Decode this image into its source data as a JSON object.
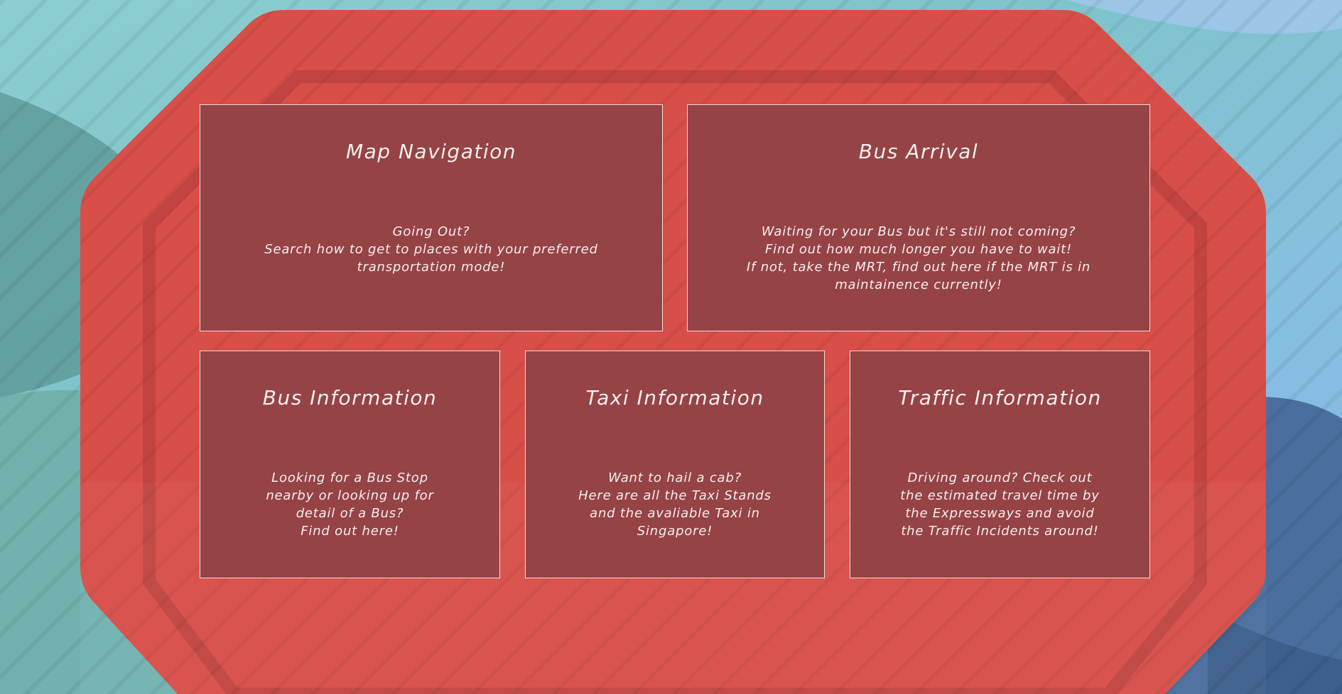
{
  "colors": {
    "sky": "#8ccfd0",
    "octagon": "#d84e48",
    "octagon_inner_border": "#b9423e",
    "card_bg": "#954345",
    "card_border": "#f1dcdc",
    "card_text": "#f6eeee",
    "mountain_dark_blue": "#4a6e9e",
    "mountain_teal": "#6aa8a6"
  },
  "cards": [
    {
      "title": "Map Navigation",
      "lines": [
        "Going Out?",
        "Search how to get to places with your preferred",
        "transportation mode!"
      ]
    },
    {
      "title": "Bus Arrival",
      "lines": [
        "Waiting for your Bus but it's still not coming?",
        "Find out how much longer you have to wait!",
        "If not, take the MRT, find out here if the MRT is in",
        "maintainence currently!"
      ]
    },
    {
      "title": "Bus Information",
      "lines": [
        "Looking for a Bus Stop",
        "nearby or looking up for",
        "detail of a Bus?",
        "Find out here!"
      ]
    },
    {
      "title": "Taxi Information",
      "lines": [
        "Want to hail a cab?",
        "Here are all the Taxi Stands",
        "and the avaliable Taxi in",
        "Singapore!"
      ]
    },
    {
      "title": "Traffic Information",
      "lines": [
        "Driving around? Check out",
        "the estimated travel time by",
        "the Expressways and avoid",
        "the Traffic Incidents around!"
      ]
    }
  ]
}
